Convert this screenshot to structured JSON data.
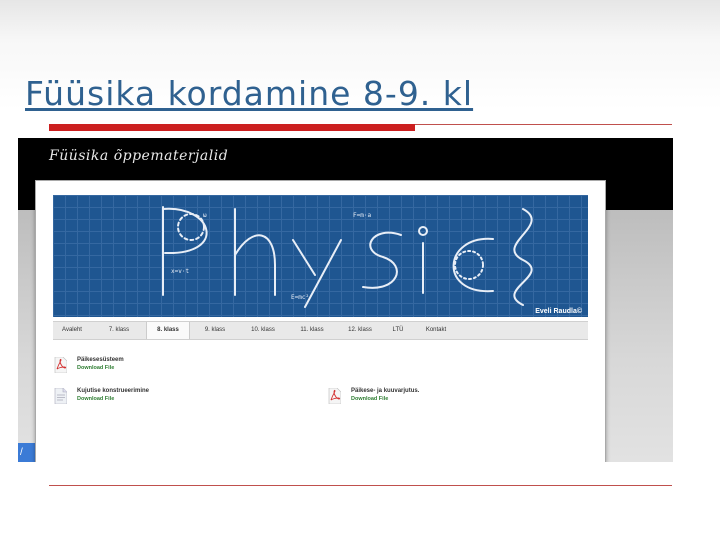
{
  "slide": {
    "title": "Füüsika kordamine 8-9. kl"
  },
  "site": {
    "header_title": "Füüsika õppematerjalid",
    "banner_word": "Physics",
    "banner_credit": "Eveli Raudla©",
    "nav": [
      {
        "label": "Avaleht",
        "active": false
      },
      {
        "label": "7. klass",
        "active": false
      },
      {
        "label": "8. klass",
        "active": true
      },
      {
        "label": "9. klass",
        "active": false
      },
      {
        "label": "10. klass",
        "active": false
      },
      {
        "label": "11. klass",
        "active": false
      },
      {
        "label": "12. klass",
        "active": false
      },
      {
        "label": "LTÜ",
        "active": false
      },
      {
        "label": "Kontakt",
        "active": false
      }
    ],
    "files": [
      {
        "name": "Päikesesüsteem",
        "link": "Download File",
        "icon": "pdf-icon"
      },
      {
        "name": "Kujutise konstrueerimine",
        "link": "Download File",
        "icon": "document-icon"
      },
      {
        "name": "Päikese- ja kuuvarjutus.",
        "link": "Download File",
        "icon": "pdf-icon"
      }
    ]
  },
  "colors": {
    "title": "#2f6190",
    "accent_red": "#cc1f1f",
    "banner_blue": "#1f5691",
    "link_green": "#2e7d32"
  }
}
